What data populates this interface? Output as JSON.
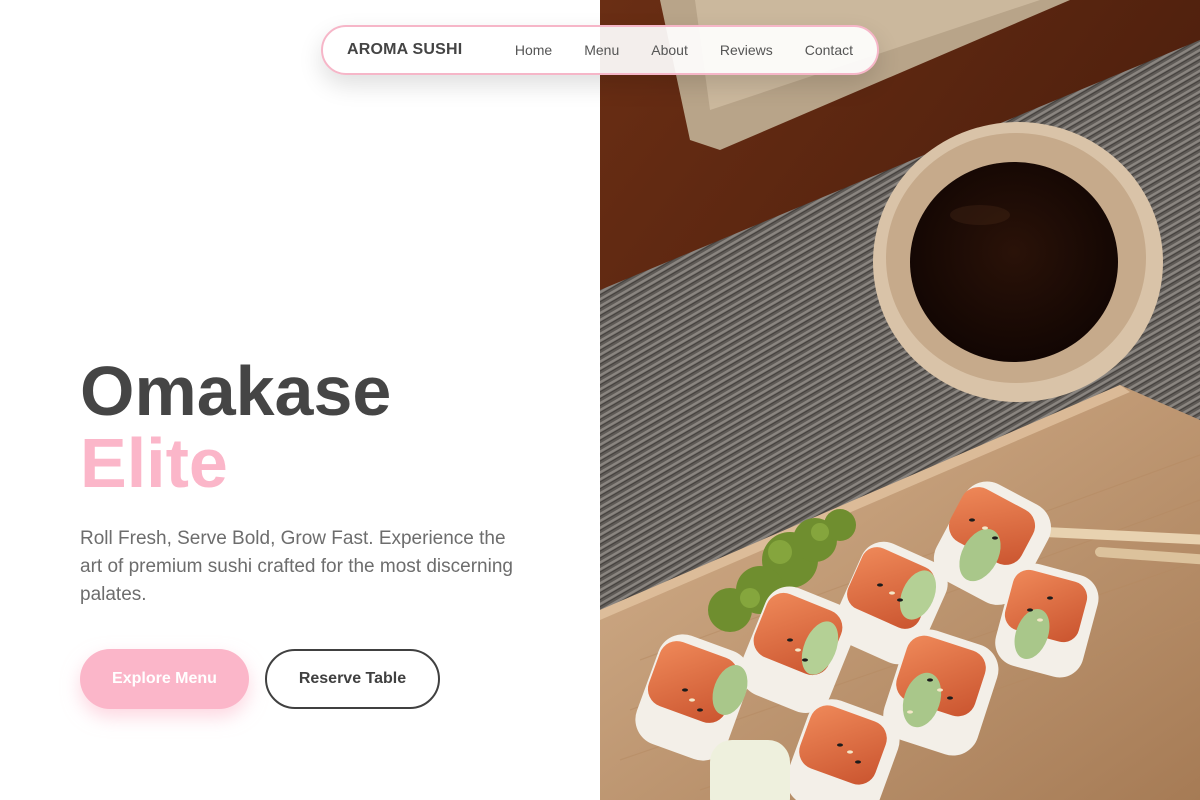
{
  "nav": {
    "brand": "AROMA SUSHI",
    "links": [
      "Home",
      "Menu",
      "About",
      "Reviews",
      "Contact"
    ]
  },
  "hero": {
    "title_line1": "Omakase",
    "title_line2": "Elite",
    "description": "Roll Fresh, Serve Bold, Grow Fast. Experience the art of premium sushi crafted for the most discerning palates.",
    "primary_button": "Explore Menu",
    "secondary_button": "Reserve Table",
    "image_alt": "Sushi rolls with sesame seeds, parsley, a bowl of soy sauce and chopsticks on a wooden board"
  },
  "colors": {
    "accent_pink": "#fbb6c9",
    "nav_border": "#f6b6c8",
    "text_dark": "#454545",
    "text_muted": "#6d6d6d"
  }
}
